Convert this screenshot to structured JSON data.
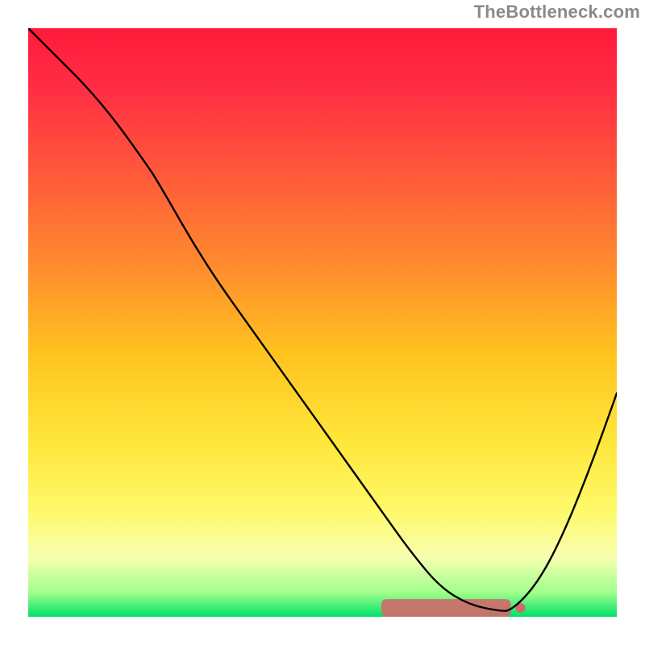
{
  "attribution": "TheBottleneck.com",
  "chart_data": {
    "type": "line",
    "title": "",
    "xlabel": "",
    "ylabel": "",
    "xlim": [
      0,
      100
    ],
    "ylim": [
      0,
      100
    ],
    "grid": false,
    "legend": false,
    "background_gradient": {
      "stops": [
        {
          "offset": 0.0,
          "color": "#ff1a3a"
        },
        {
          "offset": 0.1,
          "color": "#ff2d44"
        },
        {
          "offset": 0.25,
          "color": "#ff5a3a"
        },
        {
          "offset": 0.4,
          "color": "#ff8a2e"
        },
        {
          "offset": 0.55,
          "color": "#ffc21f"
        },
        {
          "offset": 0.7,
          "color": "#ffe63a"
        },
        {
          "offset": 0.82,
          "color": "#fff96a"
        },
        {
          "offset": 0.9,
          "color": "#f6ffb0"
        },
        {
          "offset": 0.96,
          "color": "#9dff8a"
        },
        {
          "offset": 1.0,
          "color": "#00e06a"
        }
      ]
    },
    "accent": {
      "y_band": [
        0,
        3
      ],
      "x_range": [
        60,
        82
      ],
      "color": "#cf6b6b"
    },
    "series": [
      {
        "name": "curve",
        "color": "#000000",
        "x": [
          0,
          5,
          10,
          15,
          20,
          22,
          30,
          40,
          50,
          60,
          65,
          70,
          75,
          80,
          82,
          86,
          90,
          95,
          100
        ],
        "y": [
          100,
          95,
          90,
          84,
          77,
          74,
          60,
          46,
          32,
          18,
          11,
          5,
          2,
          1,
          1,
          5,
          12,
          24,
          38
        ]
      }
    ]
  }
}
